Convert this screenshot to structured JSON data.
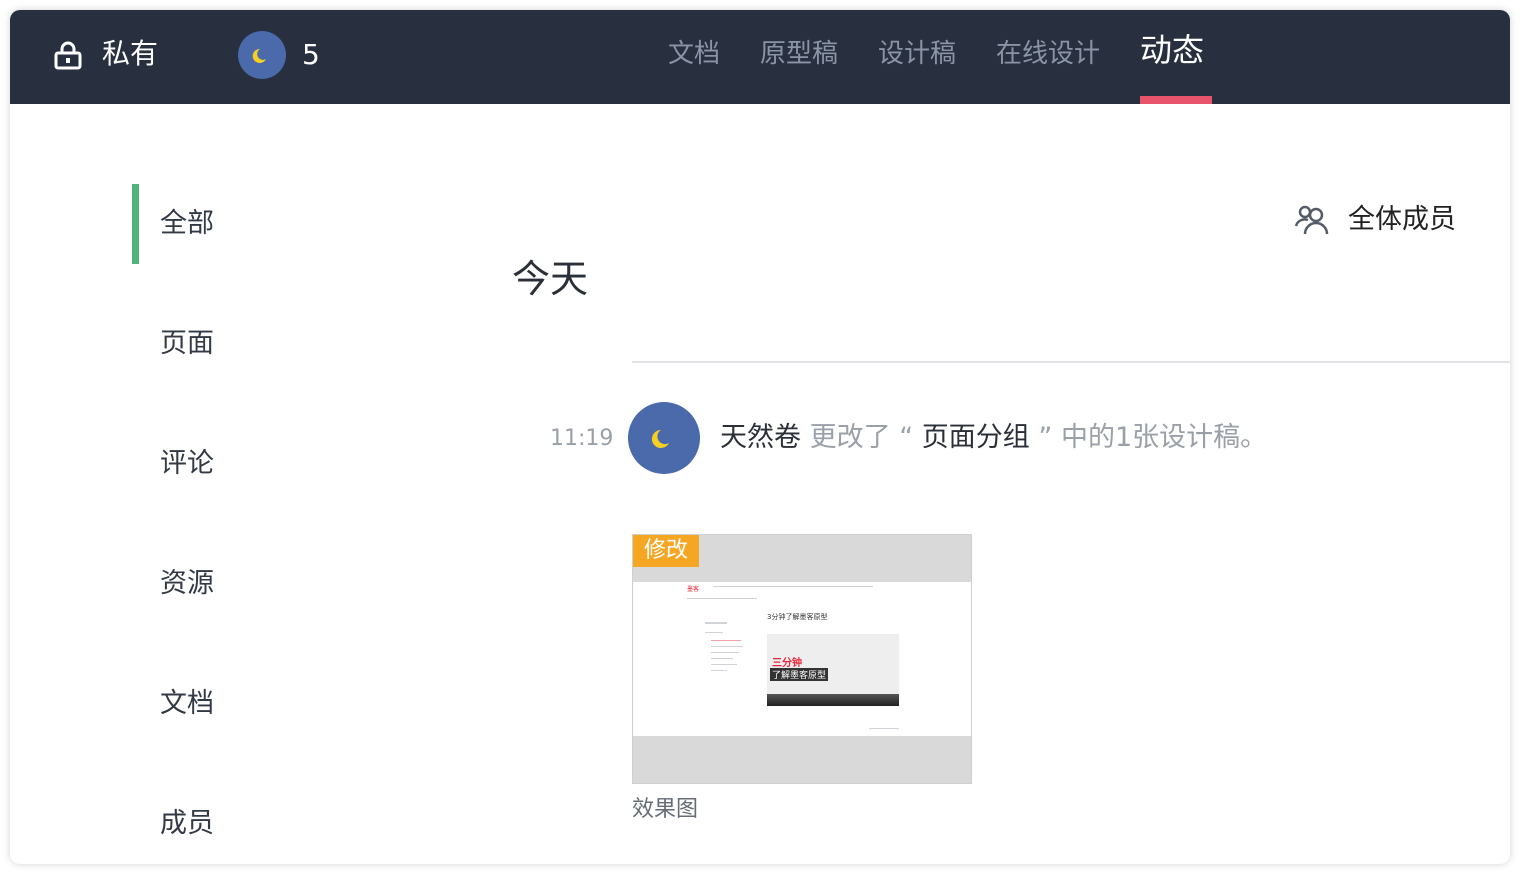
{
  "header": {
    "privacy_label": "私有",
    "member_count": "5",
    "tabs": [
      {
        "label": "文档",
        "active": false
      },
      {
        "label": "原型稿",
        "active": false
      },
      {
        "label": "设计稿",
        "active": false
      },
      {
        "label": "在线设计",
        "active": false
      },
      {
        "label": "动态",
        "active": true
      }
    ],
    "icons": {
      "privacy": "lock-icon",
      "avatar": "moon-avatar"
    }
  },
  "sidebar": {
    "items": [
      {
        "label": "全部",
        "active": true
      },
      {
        "label": "页面",
        "active": false
      },
      {
        "label": "评论",
        "active": false
      },
      {
        "label": "资源",
        "active": false
      },
      {
        "label": "文档",
        "active": false
      },
      {
        "label": "成员",
        "active": false
      }
    ]
  },
  "main": {
    "filter_label": "全体成员",
    "filter_icon": "members-icon",
    "day_heading": "今天",
    "activities": [
      {
        "time": "11:19",
        "user": "天然卷",
        "action": "更改了",
        "open_quote": "“",
        "group": "页面分组",
        "close_quote": "”",
        "suffix": "中的1张设计稿。",
        "thumbnail": {
          "badge": "修改",
          "caption": "效果图",
          "preview_red_text": "三分钟",
          "preview_dark_text": "了解墨客原型",
          "preview_title": "3分钟了解墨客原型",
          "preview_logo": "墨客"
        }
      }
    ]
  },
  "colors": {
    "topbar_bg": "#283040",
    "tab_indicator": "#e8546c",
    "sidebar_indicator": "#4fb47a",
    "avatar_bg": "#4a6aab",
    "badge_bg": "#f5a623"
  }
}
